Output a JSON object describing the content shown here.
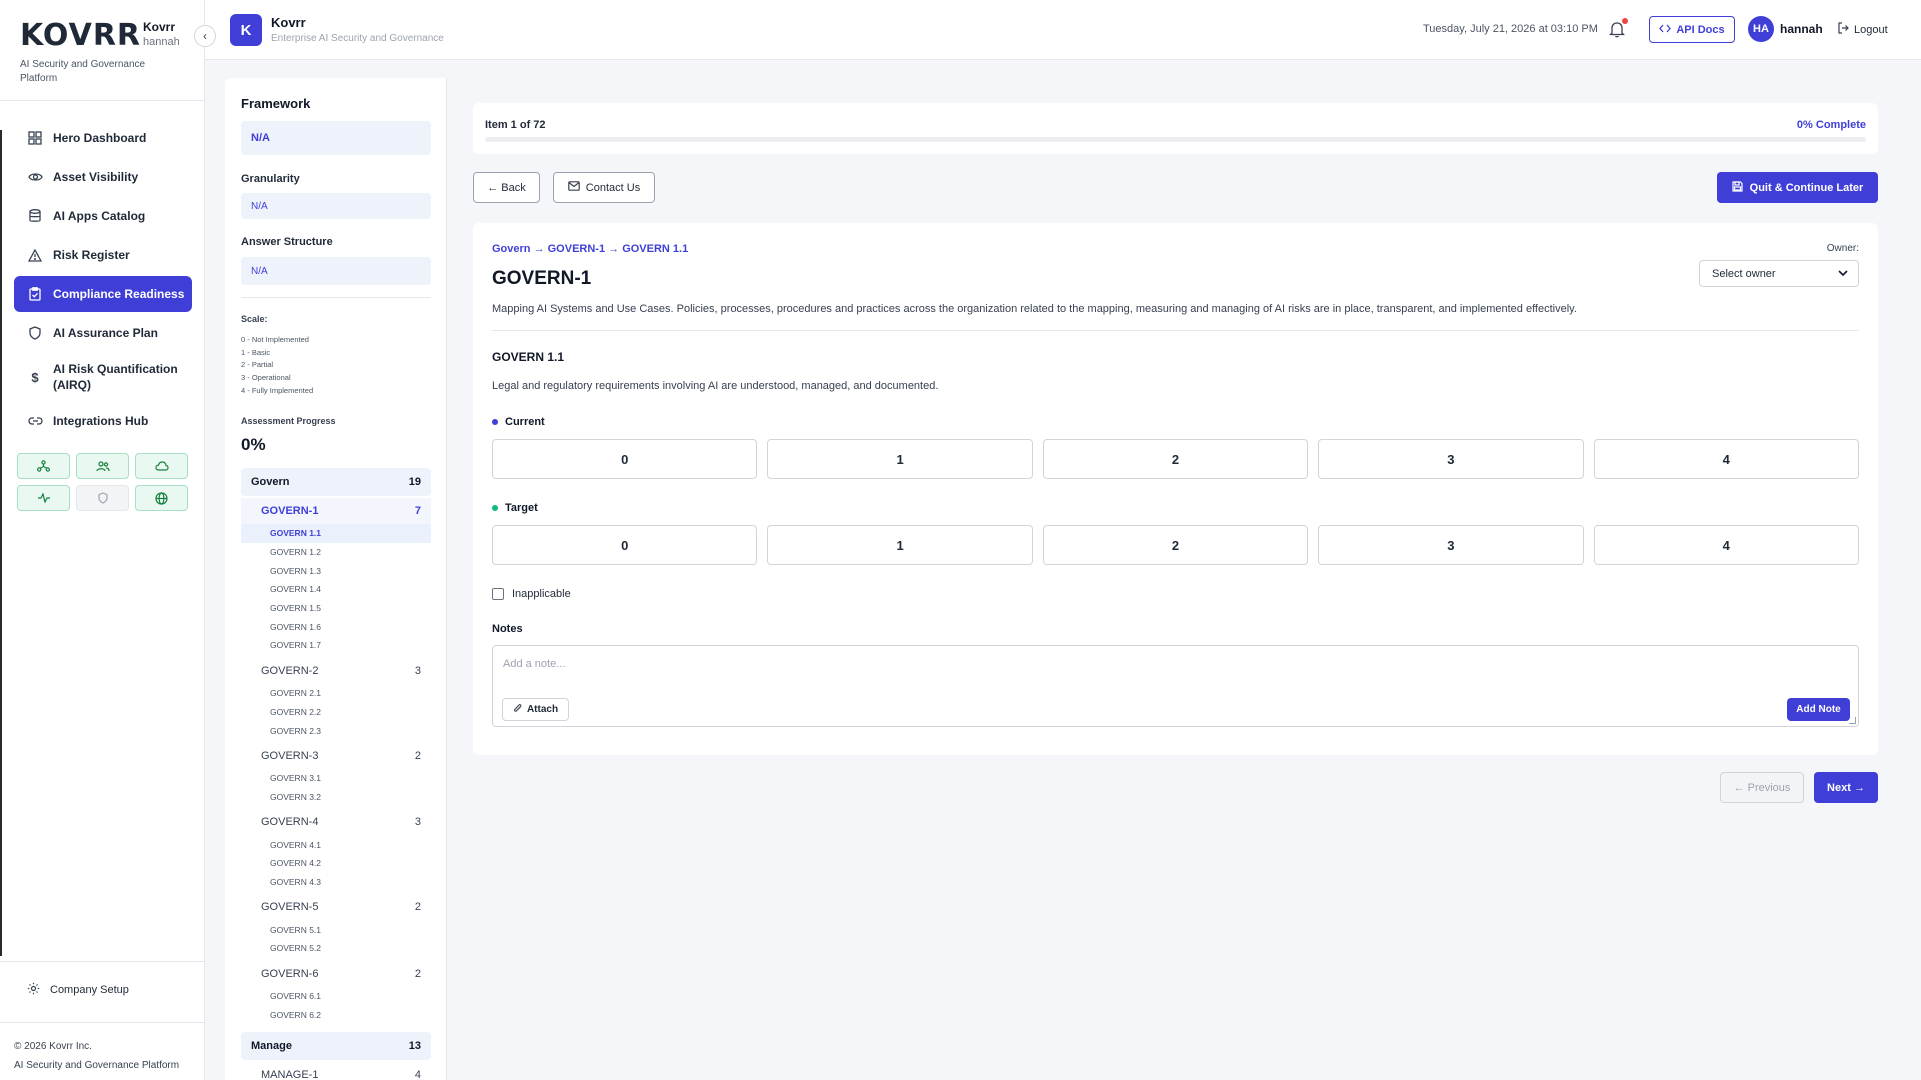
{
  "brand": {
    "logo": "KOVRR",
    "org": "Kovrr",
    "user": "hannah",
    "tagline": "AI Security and Governance Platform"
  },
  "nav": {
    "items": [
      {
        "label": "Hero Dashboard",
        "icon": "grid-icon"
      },
      {
        "label": "Asset Visibility",
        "icon": "eye-icon"
      },
      {
        "label": "AI Apps Catalog",
        "icon": "database-icon"
      },
      {
        "label": "Risk Register",
        "icon": "warning-icon"
      },
      {
        "label": "Compliance Readiness",
        "icon": "clipboard-check-icon",
        "active": true
      },
      {
        "label": "AI Assurance Plan",
        "icon": "shield-icon"
      },
      {
        "label": "AI Risk Quantification (AIRQ)",
        "icon": "dollar-icon"
      },
      {
        "label": "Integrations Hub",
        "icon": "link-icon"
      }
    ],
    "company_setup": "Company Setup"
  },
  "footer": {
    "copyright": "© 2026 Kovrr Inc.",
    "tagline": "AI Security and Governance Platform"
  },
  "header": {
    "app_initial": "K",
    "app_name": "Kovrr",
    "app_subtitle": "Enterprise AI Security and Governance",
    "datetime": "Tuesday, July 21, 2026 at 03:10 PM",
    "api_docs": "API Docs",
    "user_initials": "HA",
    "user_name": "hannah",
    "logout": "Logout"
  },
  "framework": {
    "title": "Framework",
    "value": "N/A",
    "granularity_label": "Granularity",
    "granularity_value": "N/A",
    "answer_structure_label": "Answer Structure",
    "answer_structure_value": "N/A",
    "scale_title": "Scale:",
    "scale": [
      "0 - Not Implemented",
      "1 - Basic",
      "2 - Partial",
      "3 - Operational",
      "4 - Fully Implemented"
    ],
    "progress_label": "Assessment Progress",
    "progress_value": "0%",
    "sections": [
      {
        "name": "Govern",
        "count": "19",
        "groups": [
          {
            "name": "GOVERN-1",
            "count": "7",
            "active": true,
            "subs": [
              "GOVERN 1.1",
              "GOVERN 1.2",
              "GOVERN 1.3",
              "GOVERN 1.4",
              "GOVERN 1.5",
              "GOVERN 1.6",
              "GOVERN 1.7"
            ]
          },
          {
            "name": "GOVERN-2",
            "count": "3",
            "subs": [
              "GOVERN 2.1",
              "GOVERN 2.2",
              "GOVERN 2.3"
            ]
          },
          {
            "name": "GOVERN-3",
            "count": "2",
            "subs": [
              "GOVERN 3.1",
              "GOVERN 3.2"
            ]
          },
          {
            "name": "GOVERN-4",
            "count": "3",
            "subs": [
              "GOVERN 4.1",
              "GOVERN 4.2",
              "GOVERN 4.3"
            ]
          },
          {
            "name": "GOVERN-5",
            "count": "2",
            "subs": [
              "GOVERN 5.1",
              "GOVERN 5.2"
            ]
          },
          {
            "name": "GOVERN-6",
            "count": "2",
            "subs": [
              "GOVERN 6.1",
              "GOVERN 6.2"
            ]
          }
        ]
      },
      {
        "name": "Manage",
        "count": "13",
        "groups": [
          {
            "name": "MANAGE-1",
            "count": "4",
            "subs": []
          }
        ]
      }
    ]
  },
  "assessment": {
    "item_text": "Item 1 of 72",
    "complete_text": "0% Complete",
    "progress_fraction": 0,
    "back": "← Back",
    "contact": "Contact Us",
    "quit": "Quit & Continue Later",
    "breadcrumb": "Govern → GOVERN-1 → GOVERN 1.1",
    "owner_label": "Owner:",
    "owner_value": "Select owner",
    "title": "GOVERN-1",
    "description": "Mapping AI Systems and Use Cases. Policies, processes, procedures and practices across the organization related to the mapping, measuring and managing of AI risks are in place, transparent, and implemented effectively.",
    "sub_title": "GOVERN 1.1",
    "sub_description": "Legal and regulatory requirements involving AI are understood, managed, and documented.",
    "current_label": "Current",
    "target_label": "Target",
    "ratings": [
      "0",
      "1",
      "2",
      "3",
      "4"
    ],
    "inapplicable": "Inapplicable",
    "notes_label": "Notes",
    "notes_placeholder": "Add a note...",
    "attach": "Attach",
    "add_note": "Add Note",
    "previous": "← Previous",
    "next": "Next →"
  },
  "colors": {
    "accent": "#3f3fd8",
    "current_dot": "#3f3fd8",
    "target_dot": "#10b981"
  }
}
